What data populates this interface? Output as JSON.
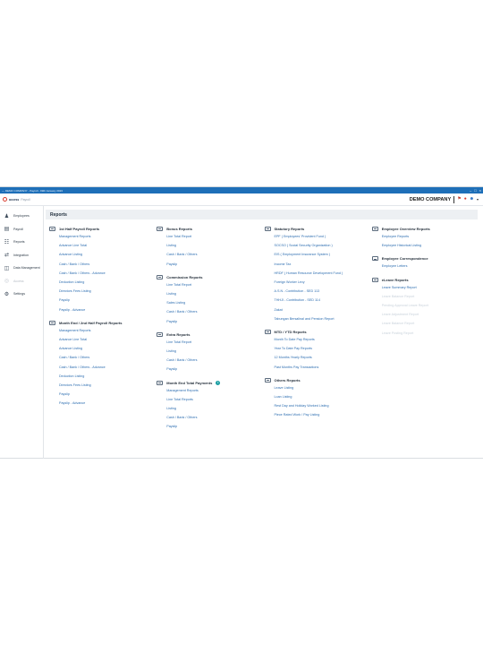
{
  "window": {
    "title": "— DEMO COMPANY - Payroll - 99th January 2023"
  },
  "header": {
    "brand": "access",
    "brand_sub": "Payroll",
    "company": "DEMO COMPANY"
  },
  "sidebar": {
    "items": [
      {
        "label": "Employees",
        "icon": "people-icon"
      },
      {
        "label": "Payroll",
        "icon": "payroll-icon"
      },
      {
        "label": "Reports",
        "icon": "reports-icon"
      },
      {
        "label": "Integration",
        "icon": "integration-icon"
      },
      {
        "label": "Data Management",
        "icon": "data-management-icon"
      },
      {
        "label": "Access",
        "icon": "access-icon",
        "disabled": true
      },
      {
        "label": "Settings",
        "icon": "gear-icon"
      }
    ]
  },
  "page": {
    "title": "Reports"
  },
  "columns": [
    {
      "groups": [
        {
          "title": "1st Half Payroll Reports",
          "items": [
            "Management Reports",
            "Advance Line Total",
            "Advance Listing",
            "Cash / Bank / Others",
            "Cash / Bank / Others - Advance",
            "Deduction Listing",
            "Directors Fees Listing",
            "Payslip",
            "Payslip - Advance"
          ]
        },
        {
          "title": "Month End / 2nd Half Payroll Reports",
          "items": [
            "Management Reports",
            "Advance Line Total",
            "Advance Listing",
            "Cash / Bank / Others",
            "Cash / Bank / Others - Advance",
            "Deduction Listing",
            "Directors Fees Listing",
            "Payslip",
            "Payslip - Advance"
          ]
        }
      ]
    },
    {
      "groups": [
        {
          "title": "Bonus Reports",
          "items": [
            "Line Total Report",
            "Listing",
            "Cash / Bank / Others",
            "Payslip"
          ]
        },
        {
          "title": "Commission Reports",
          "items": [
            "Line Total Report",
            "Listing",
            "Sales Listing",
            "Cash / Bank / Others",
            "Payslip"
          ]
        },
        {
          "title": "Extra Reports",
          "items": [
            "Line Total Report",
            "Listing",
            "Cash / Bank / Others",
            "Payslip"
          ]
        },
        {
          "title": "Month End Total Payments",
          "info": true,
          "items": [
            "Management Reports",
            "Line Total Reports",
            "Listing",
            "Cash / Bank / Others",
            "Payslip"
          ]
        }
      ]
    },
    {
      "groups": [
        {
          "title": "Statutory Reports",
          "items": [
            "EPF ( Employees' Provident Fund )",
            "SOCSO ( Social Security Organization )",
            "EIS ( Employment Insurance System )",
            "Income Tax",
            "HRDF ( Human Resource Development Fund )",
            "Foreign Worker Levy",
            "A.S.N - Contribution - SED 113",
            "THHJI - Contribution - SED 114",
            "Zakat",
            "Tabungan Bersalinal and Pension Report"
          ]
        },
        {
          "title": "MTD / YTD Reports",
          "items": [
            "Month To Date Pay Reports",
            "Year To Date Pay Reports",
            "12 Months Yearly Reports",
            "Past Months Pay Transactions"
          ]
        },
        {
          "title": "Others Reports",
          "items": [
            "Leave Listing",
            "Loan Listing",
            "Rest Day and Holiday Worked Listing",
            "Piece Rated Work / Pay Listing"
          ]
        }
      ]
    },
    {
      "groups": [
        {
          "title": "Employee Overview Reports",
          "items": [
            "Employee Reports",
            "Employee Historical Listing"
          ]
        },
        {
          "title": "Employee Correspondence",
          "items": [
            "Employee Letters"
          ]
        },
        {
          "title": "eLeave Reports",
          "items": [
            "Leave Summary Report",
            "Leave Balance Report",
            "Pending Approval Leave Report",
            "Leave Adjustment Report",
            "Leave Balance Report",
            "Leave Posting Report"
          ],
          "dim": true
        }
      ]
    }
  ]
}
